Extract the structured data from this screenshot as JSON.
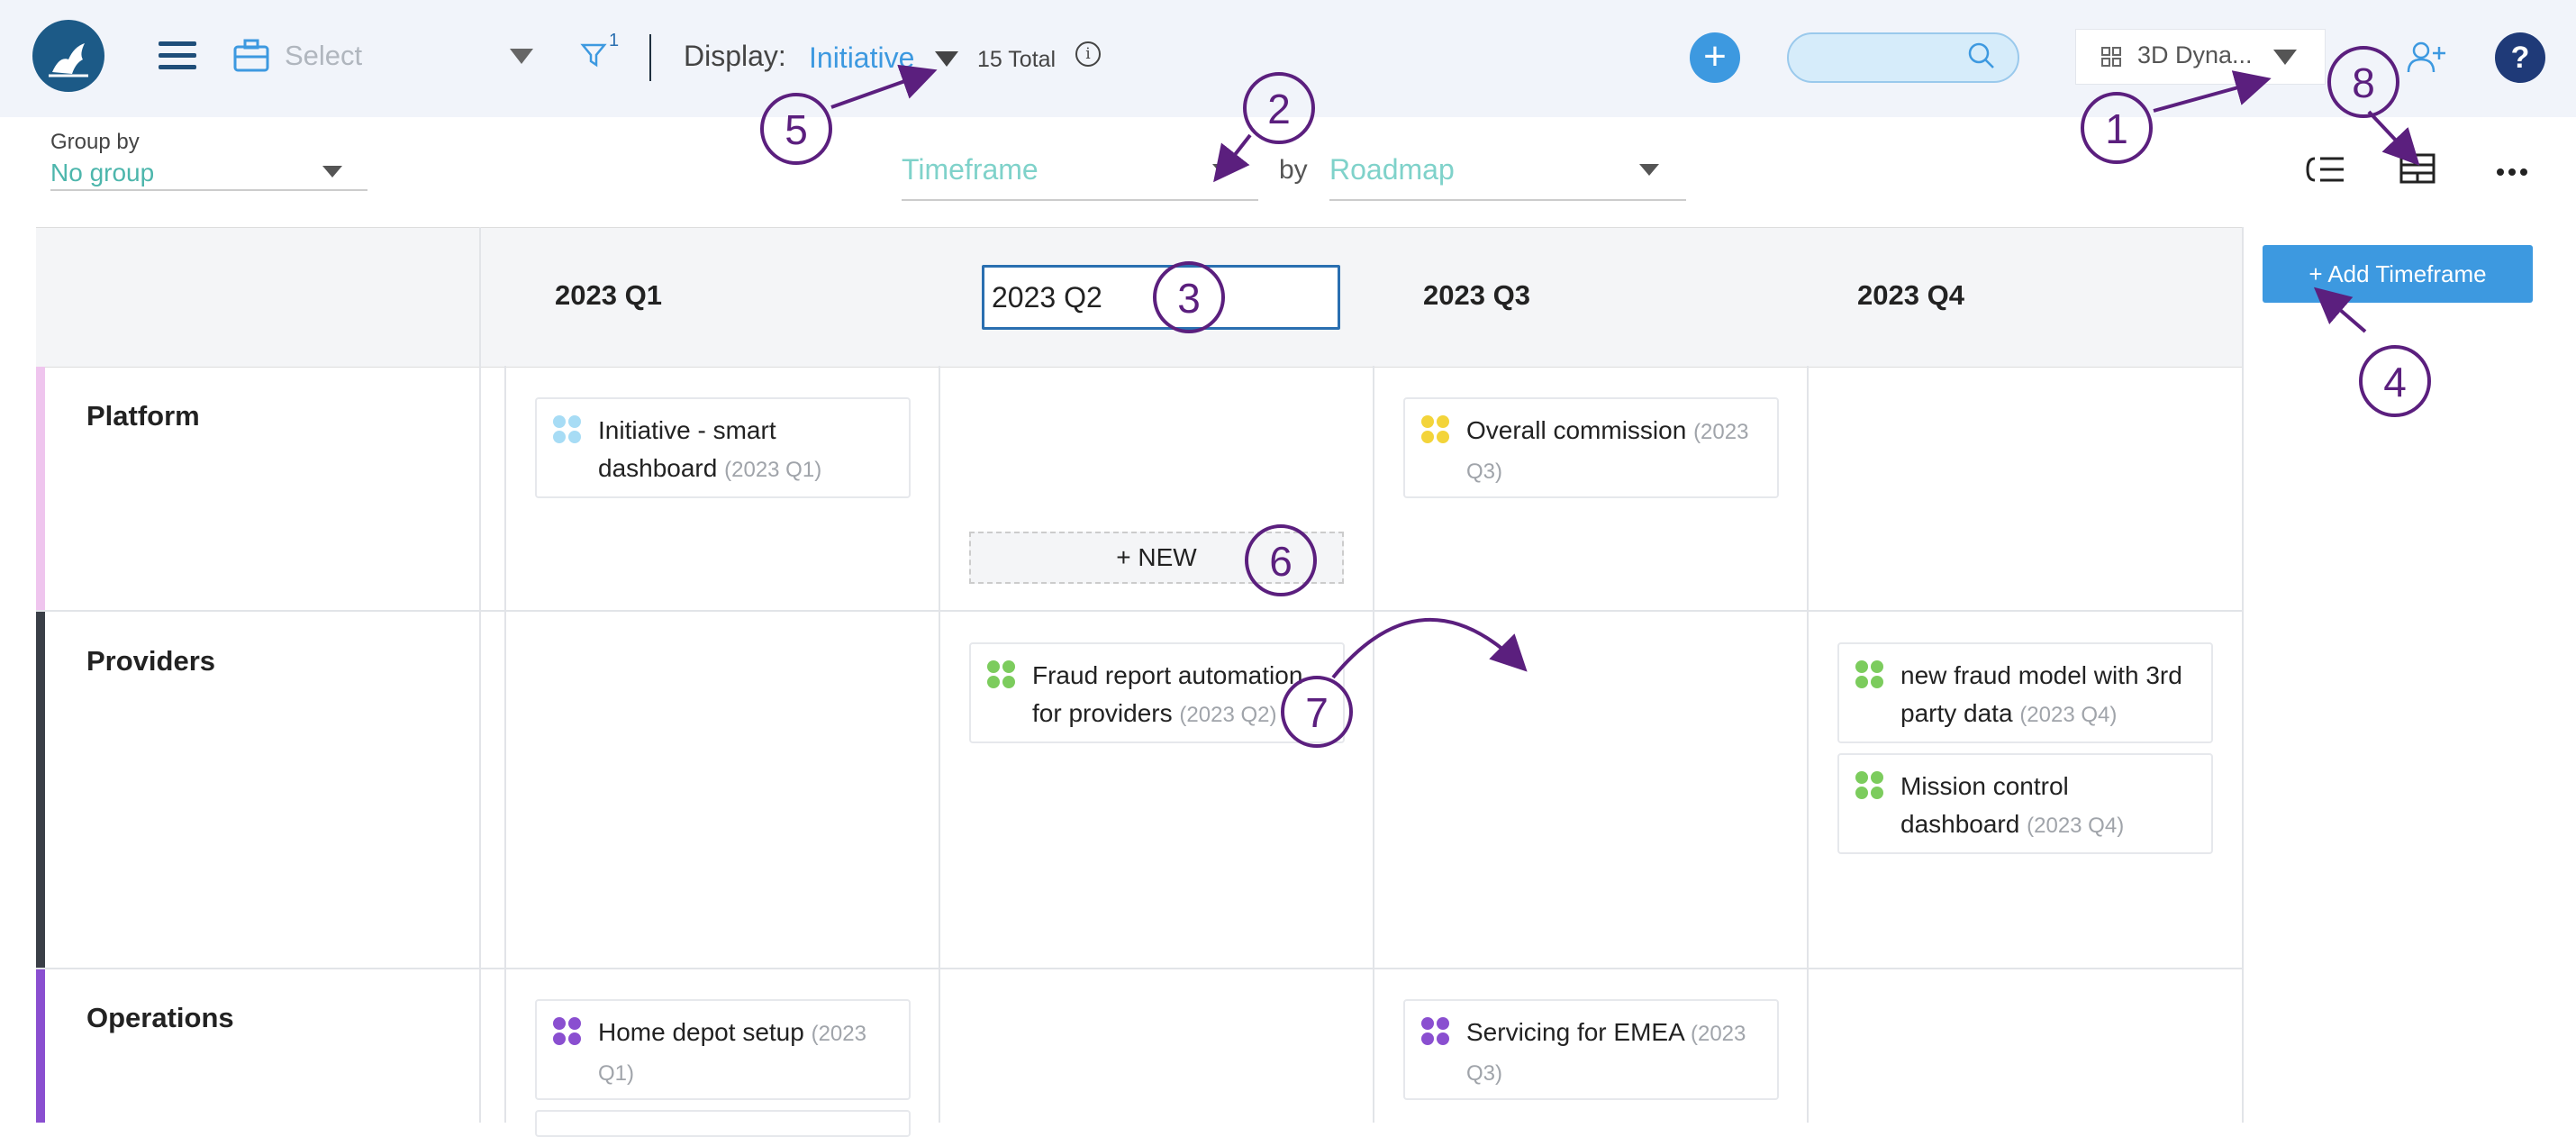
{
  "topbar": {
    "select_label": "Select",
    "filter_count": "1",
    "display_label": "Display:",
    "display_value": "Initiative",
    "total": "15 Total",
    "info_glyph": "i",
    "add_glyph": "+",
    "board_name": "3D Dyna...",
    "help_glyph": "?"
  },
  "controls": {
    "groupby_label": "Group by",
    "groupby_value": "No group",
    "timeframe_value": "Timeframe",
    "by_label": "by",
    "roadmap_value": "Roadmap"
  },
  "columns": [
    "2023 Q1",
    "2023 Q2",
    "2023 Q3",
    "2023 Q4"
  ],
  "add_timeframe_label": "+ Add Timeframe",
  "rows": [
    {
      "name": "Platform",
      "color": "#efc5ee"
    },
    {
      "name": "Providers",
      "color": "#3a3f47"
    },
    {
      "name": "Operations",
      "color": "#8a4fd0"
    }
  ],
  "cards": [
    {
      "title": "Initiative - smart",
      "title2": "dashboard",
      "tag": "(2023 Q1)",
      "color": "#a7dcf5"
    },
    {
      "title": "Overall commission",
      "tag": "(2023",
      "tag2": "Q3)",
      "color": "#f3d43a"
    },
    {
      "title": "Fraud report automation",
      "title2": "for providers",
      "tag": "(2023 Q2)",
      "color": "#7ccc5d"
    },
    {
      "title": "new fraud model with 3rd",
      "title2": "party data",
      "tag": "(2023 Q4)",
      "color": "#7ccc5d"
    },
    {
      "title": "Mission control",
      "title2": "dashboard",
      "tag": "(2023 Q4)",
      "color": "#7ccc5d"
    },
    {
      "title": "Home depot setup",
      "tag": "(2023",
      "tag2": "Q1)",
      "color": "#8a4fd0"
    },
    {
      "title": "Servicing for EMEA",
      "tag": "(2023",
      "tag2": "Q3)",
      "color": "#8a4fd0"
    }
  ],
  "new_label": "+ NEW",
  "annotations": [
    "1",
    "2",
    "3",
    "4",
    "5",
    "6",
    "7",
    "8"
  ],
  "annotation_color": "#5b1f7e"
}
